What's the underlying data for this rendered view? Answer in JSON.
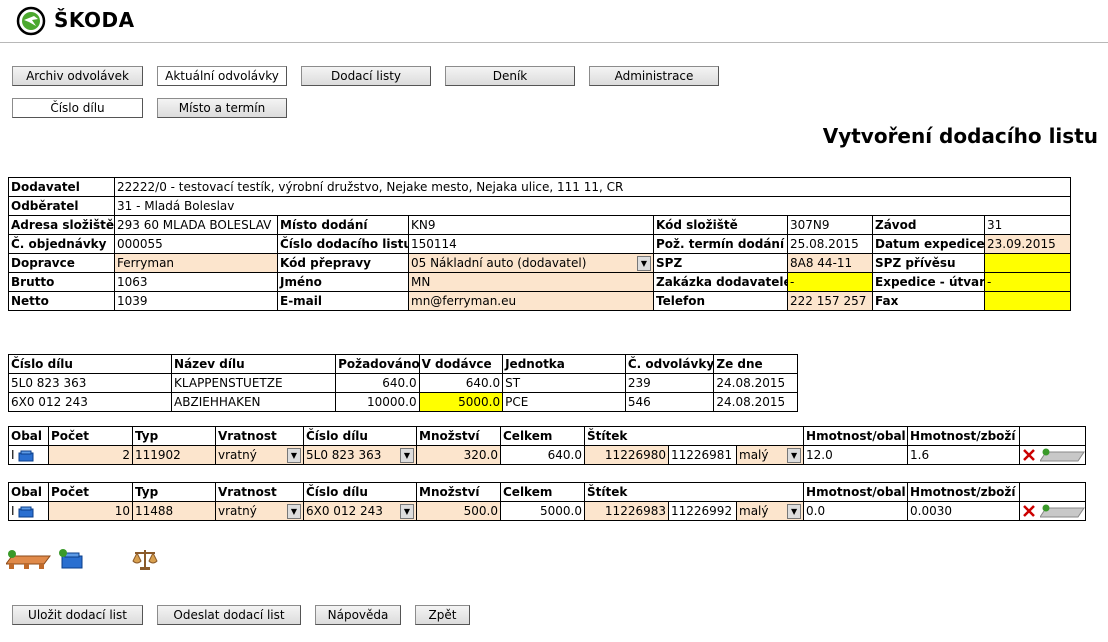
{
  "brand": {
    "name": "ŠKODA",
    "color": "#4ba82e"
  },
  "nav": {
    "row1": [
      "Archiv odvolávek",
      "Aktuální odvolávky",
      "Dodací listy",
      "Deník",
      "Administrace"
    ],
    "row2": [
      "Číslo dílu",
      "Místo a termín"
    ]
  },
  "page_title": "Vytvoření dodacího listu",
  "header_info": {
    "dodavatel_label": "Dodavatel",
    "dodavatel_value": "22222/0  -  testovací testík, výrobní družstvo,   Nejake mesto,   Nejaka ulice,   111 11,   CR",
    "odberatel_label": "Odběratel",
    "odberatel_value": "31 - Mladá Boleslav",
    "adresa_label": "Adresa složiště",
    "adresa_value": "293 60 MLADA BOLESLAV",
    "misto_label": "Místo dodání",
    "misto_value": "KN9",
    "kod_slo_label": "Kód složiště",
    "kod_slo_value": "307N9",
    "zavod_label": "Závod",
    "zavod_value": "31",
    "obj_label": "Č. objednávky",
    "obj_value": "000055",
    "cdl_label": "Číslo dodacího listu",
    "cdl_value": "150114",
    "poz_label": "Pož. termín dodání",
    "poz_value": "25.08.2015",
    "dat_label": "Datum expedice",
    "dat_value": "23.09.2015",
    "dopr_label": "Dopravce",
    "dopr_value": "Ferryman",
    "kodp_label": "Kód přepravy",
    "kodp_value": "05 Nákladní auto (dodavatel)",
    "spz_label": "SPZ",
    "spz_value": "8A8 44-11",
    "spzp_label": "SPZ přívěsu",
    "spzp_value": "",
    "brutto_label": "Brutto",
    "brutto_value": "1063",
    "jmeno_label": "Jméno",
    "jmeno_value": "MN",
    "zak_label": "Zakázka dodavatele",
    "zak_value": "-",
    "exp_label": "Expedice - útvar",
    "exp_value": "-",
    "netto_label": "Netto",
    "netto_value": "1039",
    "email_label": "E-mail",
    "email_value": "mn@ferryman.eu",
    "tel_label": "Telefon",
    "tel_value": "222 157 257",
    "fax_label": "Fax",
    "fax_value": ""
  },
  "parts": {
    "headers": [
      "Číslo dílu",
      "Název dílu",
      "Požadováno",
      "V dodávce",
      "Jednotka",
      "Č. odvolávky",
      "Ze dne"
    ],
    "rows": [
      [
        "5L0 823 363",
        "KLAPPENSTUETZE",
        "640.0",
        "640.0",
        "ST",
        "239",
        "24.08.2015"
      ],
      [
        "6X0 012 243",
        "ABZIEHHAKEN",
        "10000.0",
        "5000.0",
        "PCE",
        "546",
        "24.08.2015"
      ]
    ]
  },
  "pack_headers": [
    "Obal",
    "Počet",
    "Typ",
    "Vratnost",
    "Číslo dílu",
    "Množství",
    "Celkem",
    "Štítek",
    "Hmotnost/obal",
    "Hmotnost/zboží"
  ],
  "packs": [
    {
      "obal": "I",
      "pocet": "2",
      "typ": "111902",
      "vratnost": "vratný",
      "dil": "5L0 823 363",
      "mnozstvi": "320.0",
      "celkem": "640.0",
      "stitek1": "11226980",
      "stitek2": "11226981",
      "velikost": "malý",
      "hm_obal": "12.0",
      "hm_zbozi": "1.6"
    },
    {
      "obal": "I",
      "pocet": "10",
      "typ": "11488",
      "vratnost": "vratný",
      "dil": "6X0 012 243",
      "mnozstvi": "500.0",
      "celkem": "5000.0",
      "stitek1": "11226983",
      "stitek2": "11226992",
      "velikost": "malý",
      "hm_obal": "0.0",
      "hm_zbozi": "0.0030"
    }
  ],
  "bottom_buttons": [
    "Uložit dodací list",
    "Odeslat dodací list",
    "Nápověda",
    "Zpět"
  ],
  "colors": {
    "peach": "#fce5cd",
    "yellow": "#ffff00",
    "delete_red": "#cc0000",
    "add_green": "#3a9a2a"
  }
}
